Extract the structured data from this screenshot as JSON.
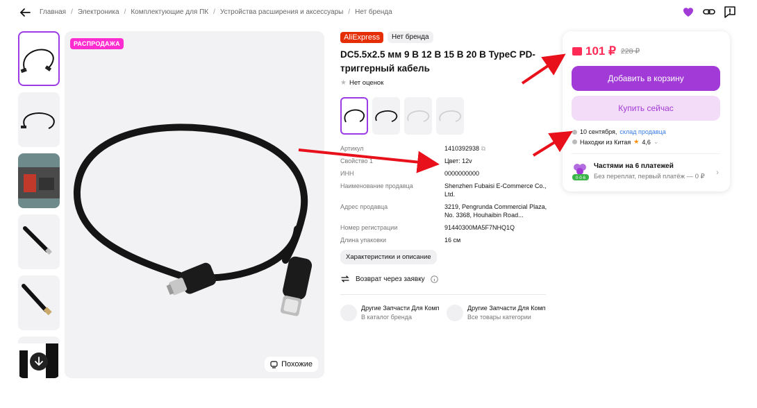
{
  "breadcrumbs": [
    "Главная",
    "Электроника",
    "Комплектующие для ПК",
    "Устройства расширения и аксессуары",
    "Нет бренда"
  ],
  "gallery": {
    "sale_badge": "РАСПРОДАЖА",
    "similar_label": "Похожие"
  },
  "product": {
    "store_logo": "AliExpress",
    "brand": "Нет бренда",
    "title": "DC5.5x2.5 мм 9 В 12 В 15 В 20 В TypeC PD-триггерный кабель",
    "rating_text": "Нет оценок",
    "specs": [
      {
        "key": "Артикул",
        "value": "1410392938"
      },
      {
        "key": "Свойство 1",
        "value": "Цвет: 12v"
      },
      {
        "key": "ИНН",
        "value": "0000000000"
      },
      {
        "key": "Наименование продавца",
        "value": "Shenzhen Fubaisi E-Commerce Co., Ltd."
      },
      {
        "key": "Адрес продавца",
        "value": "3219, Pengrunda Commercial Plaza, No. 3368, Houhaibin Road..."
      },
      {
        "key": "Номер регистрации",
        "value": "91440300MA5F7NHQ1Q"
      },
      {
        "key": "Длина упаковки",
        "value": "16 см"
      }
    ],
    "chars_button": "Характеристики и описание",
    "return_text": "Возврат через заявку",
    "links": [
      {
        "title": "Другие Запчасти Для Компьютеров",
        "subtitle": "В каталог бренда"
      },
      {
        "title": "Другие Запчасти Для Компьютеров",
        "subtitle": "Все товары категории"
      }
    ]
  },
  "buybox": {
    "price": "101 ₽",
    "old_price": "228 ₽",
    "cart_button": "Добавить в корзину",
    "buy_button": "Купить сейчас",
    "delivery_date": "10 сентября,",
    "delivery_stock": "склад продавца",
    "seller_label": "Находки из Китая",
    "seller_rating": "4,6",
    "installment_title": "Частями на 6 платежей",
    "installment_sub": "Без переплат, первый платёж — 0 ₽",
    "installment_badge": "0·0·6"
  },
  "colors": {
    "accent": "#a13ad6",
    "price": "#ff2a55",
    "sale": "#ff2ccf",
    "arrow": "#e8101a"
  }
}
